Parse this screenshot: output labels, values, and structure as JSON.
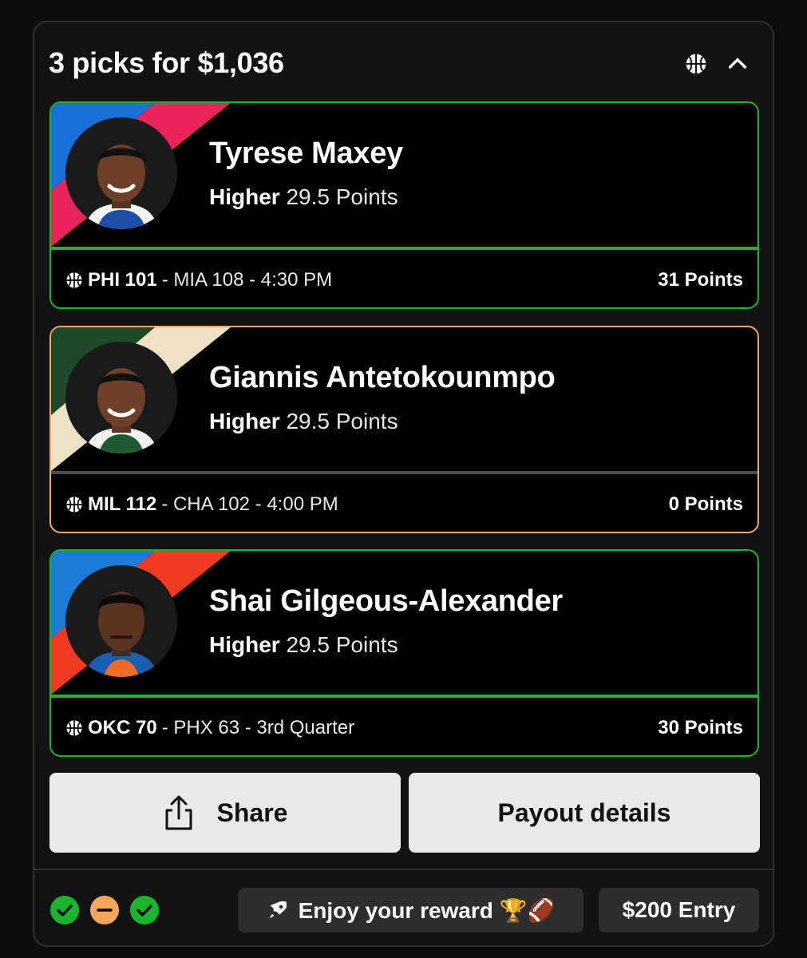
{
  "header": {
    "title": "3 picks for $1,036",
    "sport_icon": "basketball-icon",
    "collapse_icon": "chevron-up-icon"
  },
  "picks": [
    {
      "player": "Tyrese Maxey",
      "direction": "Higher",
      "line": "29.5 Points",
      "game_team": "PHI 101",
      "game_rest": "- MIA 108 - 4:30 PM",
      "result": "31 Points",
      "status": "won",
      "border_color": "#19b62c",
      "stripe_colors": [
        "#1d6fd8",
        "#e8245b",
        "#c8102e"
      ],
      "jersey_color": "#1d4fa8"
    },
    {
      "player": "Giannis Antetokounmpo",
      "direction": "Higher",
      "line": "29.5 Points",
      "game_team": "MIL 112",
      "game_rest": "- CHA 102 - 4:00 PM",
      "result": "0 Points",
      "status": "void",
      "border_color": "#f2a86a",
      "stripe_colors": [
        "#1f4a2a",
        "#eee1c6",
        "#0e3b1f"
      ],
      "jersey_color": "#1f5a34"
    },
    {
      "player": "Shai Gilgeous-Alexander",
      "direction": "Higher",
      "line": "29.5 Points",
      "game_team": "OKC 70",
      "game_rest": "- PHX 63 - 3rd Quarter",
      "result": "30 Points",
      "status": "won",
      "border_color": "#19b62c",
      "stripe_colors": [
        "#1d7bd8",
        "#ef3b24",
        "#f26b24"
      ],
      "jersey_color": "#1b5fb0"
    }
  ],
  "actions": {
    "share_label": "Share",
    "share_icon": "share-icon",
    "payout_label": "Payout details"
  },
  "footer": {
    "statuses": [
      "won",
      "void",
      "won"
    ],
    "status_colors": {
      "won": "#19b62c",
      "void": "#f5a65b"
    },
    "reward_text": "Enjoy your reward 🏆🏈",
    "reward_icon": "rocket-icon",
    "entry_label": "$200 Entry"
  }
}
